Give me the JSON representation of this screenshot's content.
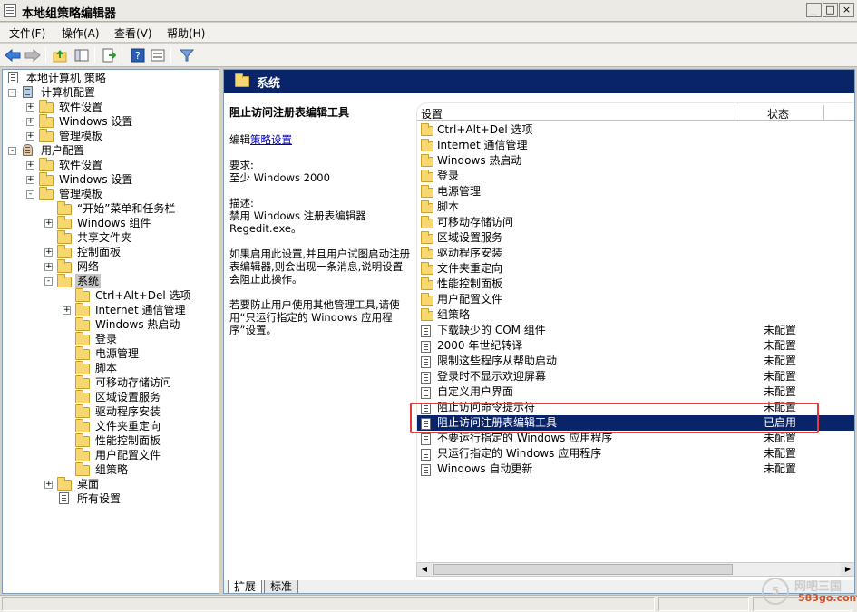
{
  "window": {
    "title": "本地组策略编辑器",
    "minimize": "_",
    "maximize": "□",
    "close": "×"
  },
  "menu": {
    "items": [
      "文件(F)",
      "操作(A)",
      "查看(V)",
      "帮助(H)"
    ]
  },
  "toolbar": {
    "icons": [
      "back-arrow-icon",
      "forward-arrow-icon",
      "up-folder-icon",
      "show-hide-tree-icon",
      "export-list-icon",
      "help-icon",
      "properties-icon",
      "filter-icon"
    ]
  },
  "tree": {
    "items": [
      {
        "label": "本地计算机 策略",
        "level": 0,
        "expander": "",
        "icon": "policy"
      },
      {
        "label": "计算机配置",
        "level": 1,
        "expander": "-",
        "icon": "computer"
      },
      {
        "label": "软件设置",
        "level": 2,
        "expander": "+",
        "icon": "folder"
      },
      {
        "label": "Windows 设置",
        "level": 2,
        "expander": "+",
        "icon": "folder"
      },
      {
        "label": "管理模板",
        "level": 2,
        "expander": "+",
        "icon": "folder"
      },
      {
        "label": "用户配置",
        "level": 1,
        "expander": "-",
        "icon": "user"
      },
      {
        "label": "软件设置",
        "level": 2,
        "expander": "+",
        "icon": "folder"
      },
      {
        "label": "Windows 设置",
        "level": 2,
        "expander": "+",
        "icon": "folder"
      },
      {
        "label": "管理模板",
        "level": 2,
        "expander": "-",
        "icon": "folder"
      },
      {
        "label": "“开始”菜单和任务栏",
        "level": 3,
        "expander": "",
        "icon": "folder"
      },
      {
        "label": "Windows 组件",
        "level": 3,
        "expander": "+",
        "icon": "folder"
      },
      {
        "label": "共享文件夹",
        "level": 3,
        "expander": "",
        "icon": "folder"
      },
      {
        "label": "控制面板",
        "level": 3,
        "expander": "+",
        "icon": "folder"
      },
      {
        "label": "网络",
        "level": 3,
        "expander": "+",
        "icon": "folder"
      },
      {
        "label": "系统",
        "level": 3,
        "expander": "-",
        "icon": "folder",
        "selected": true
      },
      {
        "label": "Ctrl+Alt+Del 选项",
        "level": 4,
        "expander": "",
        "icon": "folder"
      },
      {
        "label": "Internet 通信管理",
        "level": 4,
        "expander": "+",
        "icon": "folder"
      },
      {
        "label": "Windows 热启动",
        "level": 4,
        "expander": "",
        "icon": "folder"
      },
      {
        "label": "登录",
        "level": 4,
        "expander": "",
        "icon": "folder"
      },
      {
        "label": "电源管理",
        "level": 4,
        "expander": "",
        "icon": "folder"
      },
      {
        "label": "脚本",
        "level": 4,
        "expander": "",
        "icon": "folder"
      },
      {
        "label": "可移动存储访问",
        "level": 4,
        "expander": "",
        "icon": "folder"
      },
      {
        "label": "区域设置服务",
        "level": 4,
        "expander": "",
        "icon": "folder"
      },
      {
        "label": "驱动程序安装",
        "level": 4,
        "expander": "",
        "icon": "folder"
      },
      {
        "label": "文件夹重定向",
        "level": 4,
        "expander": "",
        "icon": "folder"
      },
      {
        "label": "性能控制面板",
        "level": 4,
        "expander": "",
        "icon": "folder"
      },
      {
        "label": "用户配置文件",
        "level": 4,
        "expander": "",
        "icon": "folder"
      },
      {
        "label": "组策略",
        "level": 4,
        "expander": "",
        "icon": "folder"
      },
      {
        "label": "桌面",
        "level": 3,
        "expander": "+",
        "icon": "folder"
      },
      {
        "label": "所有设置",
        "level": 3,
        "expander": "",
        "icon": "allsettings"
      }
    ]
  },
  "right": {
    "header": "系统",
    "desc": {
      "title": "阻止访问注册表编辑工具",
      "edit_prefix": "编辑",
      "edit_link": "策略设置",
      "req_label": "要求:",
      "req_value": "至少 Windows 2000",
      "desc_label": "描述:",
      "desc_line1": "禁用 Windows 注册表编辑器",
      "desc_line2": "Regedit.exe。",
      "para1": "如果启用此设置,并且用户试图启动注册表编辑器,则会出现一条消息,说明设置会阻止此操作。",
      "para2": "若要防止用户使用其他管理工具,请使用“只运行指定的 Windows 应用程序”设置。"
    },
    "columns": {
      "setting": "设置",
      "state": "状态"
    },
    "rows": [
      {
        "name": "Ctrl+Alt+Del 选项",
        "state": "",
        "type": "folder"
      },
      {
        "name": "Internet 通信管理",
        "state": "",
        "type": "folder"
      },
      {
        "name": "Windows 热启动",
        "state": "",
        "type": "folder"
      },
      {
        "name": "登录",
        "state": "",
        "type": "folder"
      },
      {
        "name": "电源管理",
        "state": "",
        "type": "folder"
      },
      {
        "name": "脚本",
        "state": "",
        "type": "folder"
      },
      {
        "name": "可移动存储访问",
        "state": "",
        "type": "folder"
      },
      {
        "name": "区域设置服务",
        "state": "",
        "type": "folder"
      },
      {
        "name": "驱动程序安装",
        "state": "",
        "type": "folder"
      },
      {
        "name": "文件夹重定向",
        "state": "",
        "type": "folder"
      },
      {
        "name": "性能控制面板",
        "state": "",
        "type": "folder"
      },
      {
        "name": "用户配置文件",
        "state": "",
        "type": "folder"
      },
      {
        "name": "组策略",
        "state": "",
        "type": "folder"
      },
      {
        "name": "下载缺少的 COM 组件",
        "state": "未配置",
        "type": "policy"
      },
      {
        "name": "2000 年世纪转译",
        "state": "未配置",
        "type": "policy"
      },
      {
        "name": "限制这些程序从帮助启动",
        "state": "未配置",
        "type": "policy"
      },
      {
        "name": "登录时不显示欢迎屏幕",
        "state": "未配置",
        "type": "policy"
      },
      {
        "name": "自定义用户界面",
        "state": "未配置",
        "type": "policy"
      },
      {
        "name": "阻止访问命令提示符",
        "state": "未配置",
        "type": "policy"
      },
      {
        "name": "阻止访问注册表编辑工具",
        "state": "已启用",
        "type": "policy",
        "selected": true
      },
      {
        "name": "不要运行指定的 Windows 应用程序",
        "state": "未配置",
        "type": "policy"
      },
      {
        "name": "只运行指定的 Windows 应用程序",
        "state": "未配置",
        "type": "policy"
      },
      {
        "name": "Windows 自动更新",
        "state": "未配置",
        "type": "policy"
      }
    ],
    "tabs": [
      "扩展",
      "标准"
    ]
  },
  "watermark": {
    "circle": "5",
    "line1": "网吧三国",
    "line2": "583go.com"
  },
  "colors": {
    "selection": "#0a246a",
    "header": "#0a246a",
    "highlight_box": "#e53a3a"
  }
}
